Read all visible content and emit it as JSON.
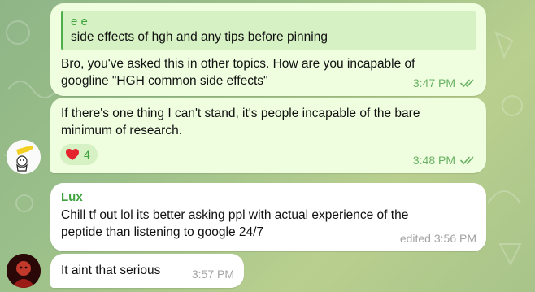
{
  "messages": {
    "m1": {
      "reply_to": {
        "name": "e e",
        "text": "side effects of hgh and any tips before pinning"
      },
      "text": "Bro, you've asked this in other topics. How are you incapable of googline \"HGH common side effects\"",
      "time": "3:47 PM"
    },
    "m2": {
      "text": "If there's one thing I can't stand, it's people incapable of the bare minimum of research.",
      "reaction": {
        "emoji": "❤️",
        "count": "4"
      },
      "time": "3:48 PM"
    },
    "m3": {
      "sender": "Lux",
      "text": "Chill tf out lol its better asking ppl with actual experience of the peptide than listening to google 24/7",
      "time": "edited 3:56 PM"
    },
    "m4": {
      "text": "It aint that serious",
      "time": "3:57 PM"
    }
  },
  "colors": {
    "outgoing_bubble": "#eefedf",
    "incoming_bubble": "#ffffff",
    "accent_green": "#3fa33f",
    "reaction_heart": "#e5232d"
  },
  "icons": {
    "read_receipt": "double-check-icon",
    "reaction": "heart-icon"
  }
}
